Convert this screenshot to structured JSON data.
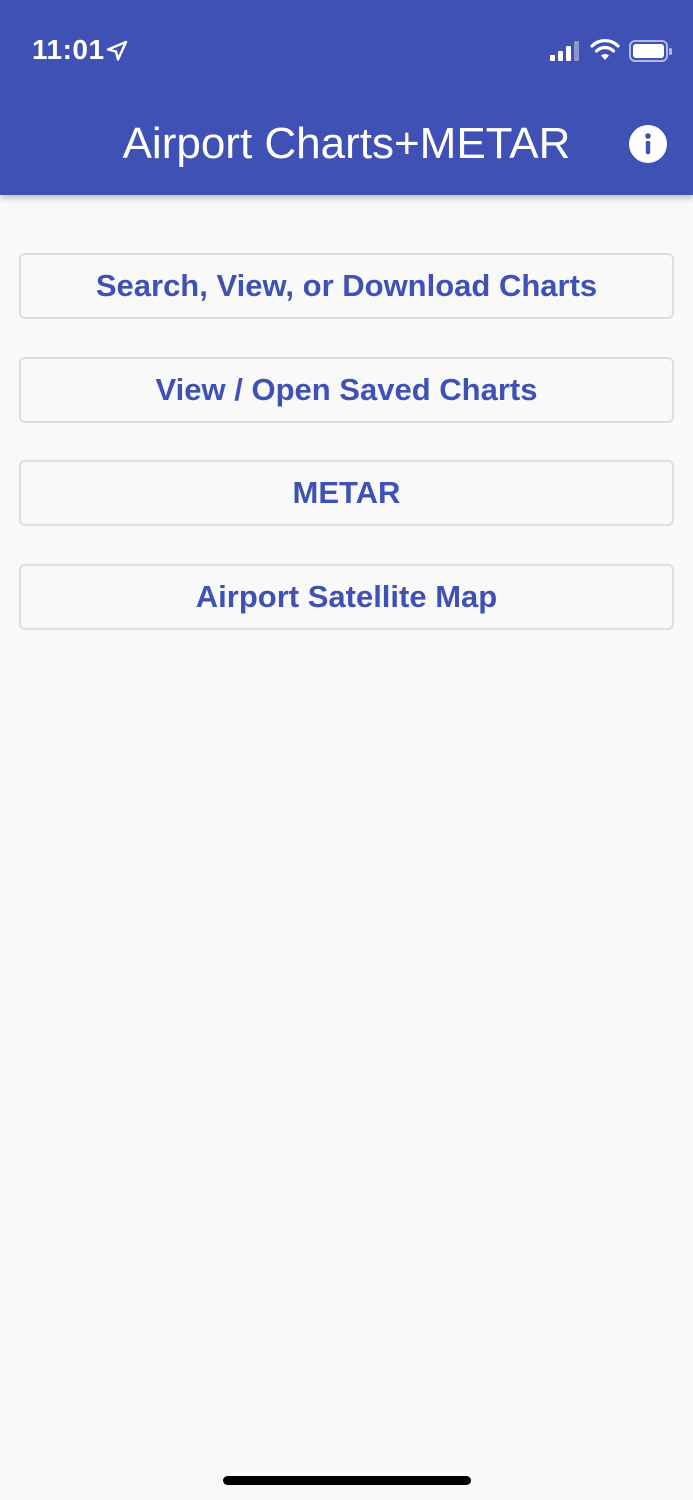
{
  "status_bar": {
    "time": "11:01",
    "icons": [
      "location-arrow-icon",
      "cellular-signal-icon",
      "wifi-icon",
      "battery-icon"
    ]
  },
  "app_bar": {
    "title": "Airport Charts+METAR",
    "info_icon": "info-icon",
    "color": "#3f51b5"
  },
  "menu": {
    "buttons": [
      {
        "label": "Search, View, or Download Charts"
      },
      {
        "label": "View / Open Saved Charts"
      },
      {
        "label": "METAR"
      },
      {
        "label": "Airport Satellite Map"
      }
    ],
    "label_color": "#3f51b5",
    "border_color": "#dedede"
  },
  "background": "#f9f9f9"
}
